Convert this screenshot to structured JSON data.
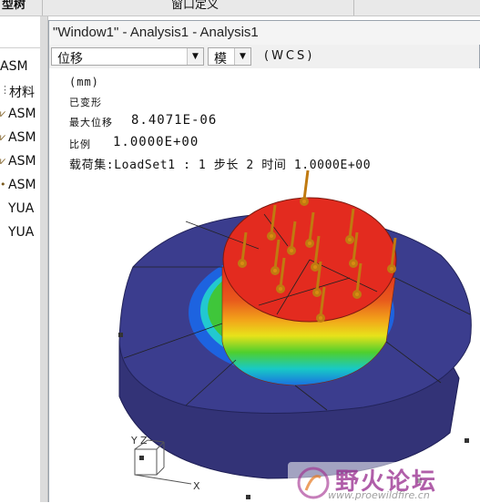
{
  "topbar": {
    "left_tab": "型树",
    "middle_tab": "窗口定义"
  },
  "model_tree": {
    "items": [
      {
        "icon": "",
        "label": "ASM"
      },
      {
        "icon": "material-icon",
        "label": "材料"
      },
      {
        "icon": "mesh-icon",
        "label": "ASM"
      },
      {
        "icon": "mesh-icon",
        "label": "ASM"
      },
      {
        "icon": "mesh-icon",
        "label": "ASM"
      },
      {
        "icon": "point-icon",
        "label": "ASM"
      },
      {
        "icon": "",
        "label": "YUA"
      },
      {
        "icon": "",
        "label": "YUA"
      }
    ]
  },
  "window": {
    "title": "\"Window1\" - Analysis1 - Analysis1",
    "toolbar": {
      "quantity_select": "位移",
      "mode_select": "模",
      "coord_system": "(WCS)"
    },
    "viewport": {
      "unit": "(mm)",
      "deformed": "已变形",
      "max_disp_label": "最大位移",
      "max_disp_value": "8.4071E-06",
      "scale_label": "比例",
      "scale_value": "1.0000E+00",
      "loadset_line": "载荷集:LoadSet1 : 1 步长 2 时间 1.0000E+00",
      "axis_labels": {
        "y": "Y",
        "z": "Z",
        "x": "X"
      }
    }
  },
  "watermark": {
    "text": "野火论坛",
    "url": "www.proewildfire.cn"
  },
  "colors": {
    "disk": "#3a3b8a",
    "hot": "#e32b1f",
    "accent": "#d98c12"
  }
}
